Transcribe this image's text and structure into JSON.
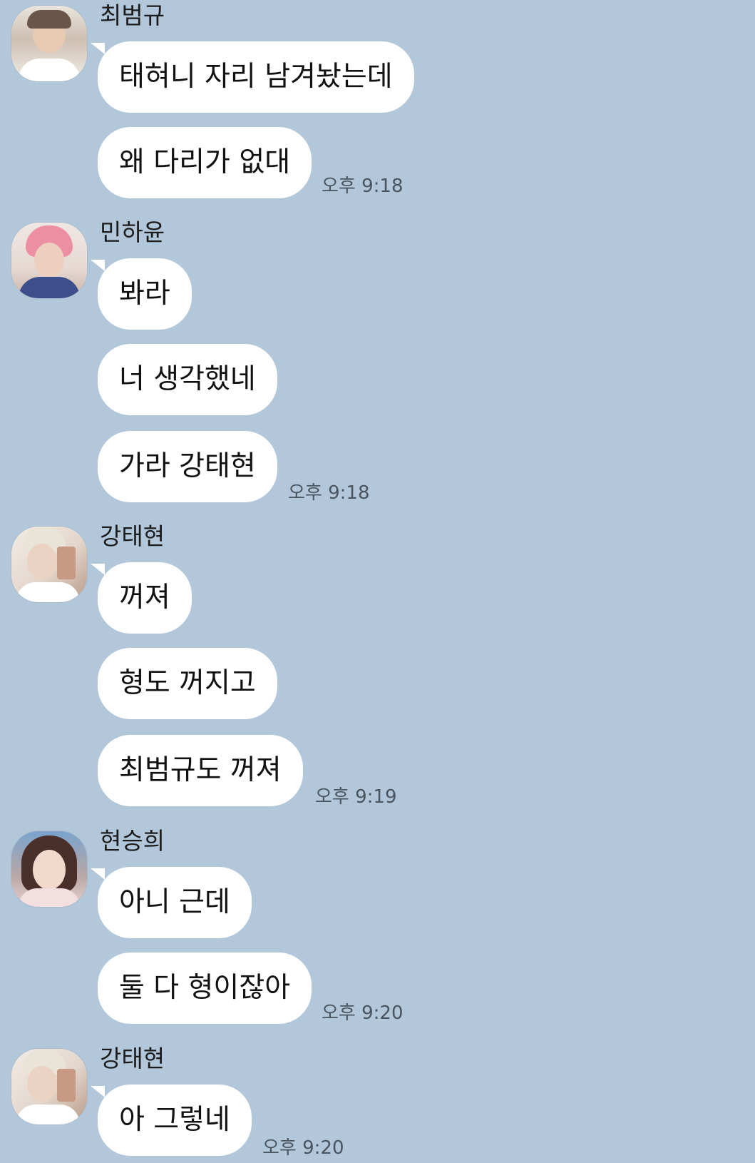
{
  "groups": [
    {
      "sender": "최범규",
      "messages": [
        "태혀니 자리 남겨놨는데",
        "왜 다리가 없대"
      ],
      "time": "오후 9:18"
    },
    {
      "sender": "민하윤",
      "messages": [
        "봐라",
        "너 생각했네",
        "가라 강태현"
      ],
      "time": "오후 9:18"
    },
    {
      "sender": "강태현",
      "messages": [
        "꺼져",
        "형도 꺼지고",
        "최범규도 꺼져"
      ],
      "time": "오후 9:19"
    },
    {
      "sender": "현승희",
      "messages": [
        "아니 근데",
        "둘 다 형이잖아"
      ],
      "time": "오후 9:20"
    },
    {
      "sender": "강태현",
      "messages": [
        "아 그렇네"
      ],
      "time": "오후 9:20"
    }
  ],
  "avatar_icons": [
    "profile-photo-icon"
  ],
  "colors": {
    "background": "#b2c7da",
    "bubble": "#ffffff"
  }
}
